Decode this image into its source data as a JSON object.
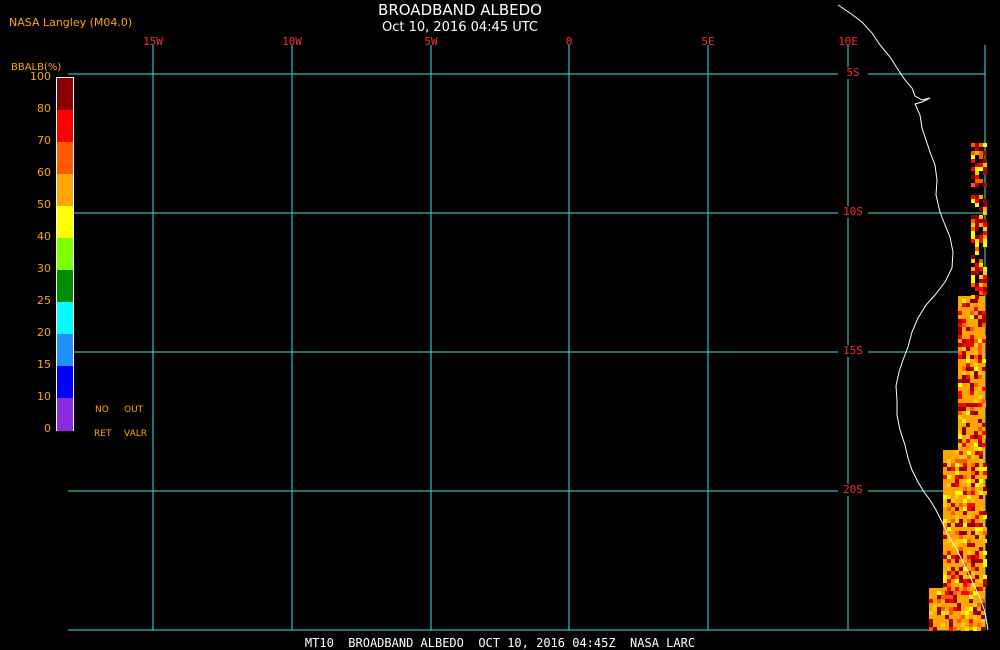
{
  "header": {
    "credit": "NASA Langley (M04.0)",
    "title": "BROADBAND ALBEDO",
    "subtitle": "Oct 10, 2016 04:45 UTC"
  },
  "footer": {
    "text": "MT10  BROADBAND ALBEDO  OCT 10, 2016 04:45Z  NASA LARC"
  },
  "map": {
    "longitude_labels": [
      "15W",
      "10W",
      "5W",
      "0",
      "5E",
      "10E"
    ],
    "latitude_labels": [
      "5S",
      "10S",
      "15S",
      "20S"
    ],
    "grid_color": "#40e0e0",
    "coastline_color": "#ffffff",
    "label_color": "#ff2a2a"
  },
  "colorbar": {
    "title": "BBALB(%)",
    "ticks": [
      "100",
      "80",
      "70",
      "60",
      "50",
      "40",
      "30",
      "25",
      "20",
      "15",
      "10",
      "0"
    ],
    "colors": [
      "#8b0000",
      "#ff0000",
      "#ff5a00",
      "#ffa500",
      "#ffff00",
      "#80ff00",
      "#008c00",
      "#00ffff",
      "#1e90ff",
      "#0000ff",
      "#8a2be2"
    ],
    "no_ret_label_top": "NO",
    "no_ret_label_bottom": "RET",
    "out_valr_label_top": "OUT",
    "out_valr_label_bottom": "VALR"
  }
}
